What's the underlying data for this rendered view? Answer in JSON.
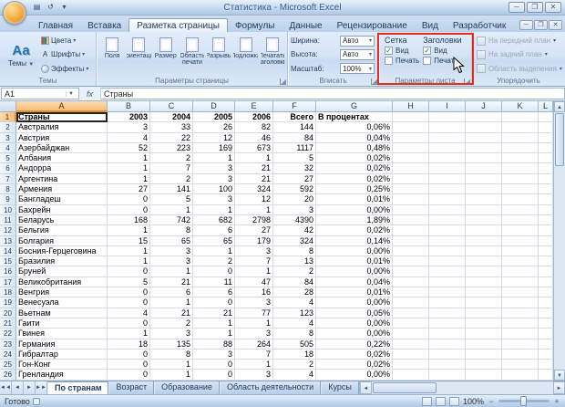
{
  "window": {
    "title": "Статистика - Microsoft Excel"
  },
  "ribbon": {
    "tabs": [
      {
        "label": "Главная",
        "active": false
      },
      {
        "label": "Вставка",
        "active": false
      },
      {
        "label": "Разметка страницы",
        "active": true
      },
      {
        "label": "Формулы",
        "active": false
      },
      {
        "label": "Данные",
        "active": false
      },
      {
        "label": "Рецензирование",
        "active": false
      },
      {
        "label": "Вид",
        "active": false
      },
      {
        "label": "Разработчик",
        "active": false
      }
    ],
    "groups": {
      "themes": {
        "label": "Темы",
        "big_button": "Темы",
        "items": [
          "Цвета",
          "Шрифты",
          "Эффекты"
        ]
      },
      "page_setup": {
        "label": "Параметры страницы",
        "buttons": [
          "Поля",
          "Ориентация",
          "Размер",
          "Область печати",
          "Разрывы",
          "Подложка",
          "Печатать заголовки"
        ]
      },
      "fit": {
        "label": "Вписать",
        "fields": [
          {
            "label": "Ширина:",
            "value": "Авто"
          },
          {
            "label": "Высота:",
            "value": "Авто"
          },
          {
            "label": "Масштаб:",
            "value": "100%"
          }
        ]
      },
      "sheet_options": {
        "label": "Параметры листа",
        "columns": [
          {
            "title": "Сетка",
            "checks": [
              {
                "label": "Вид",
                "checked": true
              },
              {
                "label": "Печать",
                "checked": false
              }
            ]
          },
          {
            "title": "Заголовки",
            "checks": [
              {
                "label": "Вид",
                "checked": true
              },
              {
                "label": "Печать",
                "checked": false
              }
            ]
          }
        ]
      },
      "arrange": {
        "label": "Упорядочить",
        "items": [
          {
            "label": "На передний план",
            "disabled": true
          },
          {
            "label": "На задний план",
            "disabled": true
          },
          {
            "label": "Область выделения",
            "disabled": false
          }
        ]
      }
    }
  },
  "formula_bar": {
    "name_box": "A1",
    "fx_label": "fx",
    "formula": "Страны"
  },
  "grid": {
    "column_letters": [
      "A",
      "B",
      "C",
      "D",
      "E",
      "F",
      "G",
      "H",
      "I",
      "J",
      "K",
      "L"
    ],
    "selected_cell": "A1",
    "header_row": [
      "Страны",
      "2003",
      "2004",
      "2005",
      "2006",
      "Всего",
      "В процентах"
    ],
    "rows": [
      [
        "Австралия",
        "3",
        "33",
        "26",
        "82",
        "144",
        "0,06%"
      ],
      [
        "Австрия",
        "4",
        "22",
        "12",
        "46",
        "84",
        "0,04%"
      ],
      [
        "Азербайджан",
        "52",
        "223",
        "169",
        "673",
        "1117",
        "0,48%"
      ],
      [
        "Албания",
        "1",
        "2",
        "1",
        "1",
        "5",
        "0,02%"
      ],
      [
        "Андорра",
        "1",
        "7",
        "3",
        "21",
        "32",
        "0,02%"
      ],
      [
        "Аргентина",
        "1",
        "2",
        "3",
        "21",
        "27",
        "0,02%"
      ],
      [
        "Армения",
        "27",
        "141",
        "100",
        "324",
        "592",
        "0,25%"
      ],
      [
        "Бангладеш",
        "0",
        "5",
        "3",
        "12",
        "20",
        "0,01%"
      ],
      [
        "Бахрейн",
        "0",
        "1",
        "1",
        "1",
        "3",
        "0,00%"
      ],
      [
        "Беларусь",
        "168",
        "742",
        "682",
        "2798",
        "4390",
        "1,89%"
      ],
      [
        "Бельгия",
        "1",
        "8",
        "6",
        "27",
        "42",
        "0,02%"
      ],
      [
        "Болгария",
        "15",
        "65",
        "65",
        "179",
        "324",
        "0,14%"
      ],
      [
        "Босния-Герцеговина",
        "1",
        "3",
        "1",
        "3",
        "8",
        "0,00%"
      ],
      [
        "Бразилия",
        "1",
        "3",
        "2",
        "7",
        "13",
        "0,01%"
      ],
      [
        "Бруней",
        "0",
        "1",
        "0",
        "1",
        "2",
        "0,00%"
      ],
      [
        "Великобритания",
        "5",
        "21",
        "11",
        "47",
        "84",
        "0,04%"
      ],
      [
        "Венгрия",
        "0",
        "6",
        "6",
        "16",
        "28",
        "0,01%"
      ],
      [
        "Венесуэла",
        "0",
        "1",
        "0",
        "3",
        "4",
        "0,00%"
      ],
      [
        "Вьетнам",
        "4",
        "21",
        "21",
        "77",
        "123",
        "0,05%"
      ],
      [
        "Гаити",
        "0",
        "2",
        "1",
        "1",
        "4",
        "0,00%"
      ],
      [
        "Гвинея",
        "1",
        "3",
        "1",
        "3",
        "8",
        "0,00%"
      ],
      [
        "Германия",
        "18",
        "135",
        "88",
        "264",
        "505",
        "0,22%"
      ],
      [
        "Гибралтар",
        "0",
        "8",
        "3",
        "7",
        "18",
        "0,02%"
      ],
      [
        "Гон-Конг",
        "0",
        "1",
        "0",
        "1",
        "2",
        "0,02%"
      ],
      [
        "Гренландия",
        "0",
        "1",
        "0",
        "3",
        "4",
        "0,00%"
      ]
    ]
  },
  "sheet_tabs": [
    {
      "label": "По странам",
      "active": true
    },
    {
      "label": "Возраст",
      "active": false
    },
    {
      "label": "Образование",
      "active": false
    },
    {
      "label": "Область деятельности",
      "active": false
    },
    {
      "label": "Курсы",
      "active": false
    }
  ],
  "status_bar": {
    "mode": "Готово",
    "zoom": "100%"
  }
}
